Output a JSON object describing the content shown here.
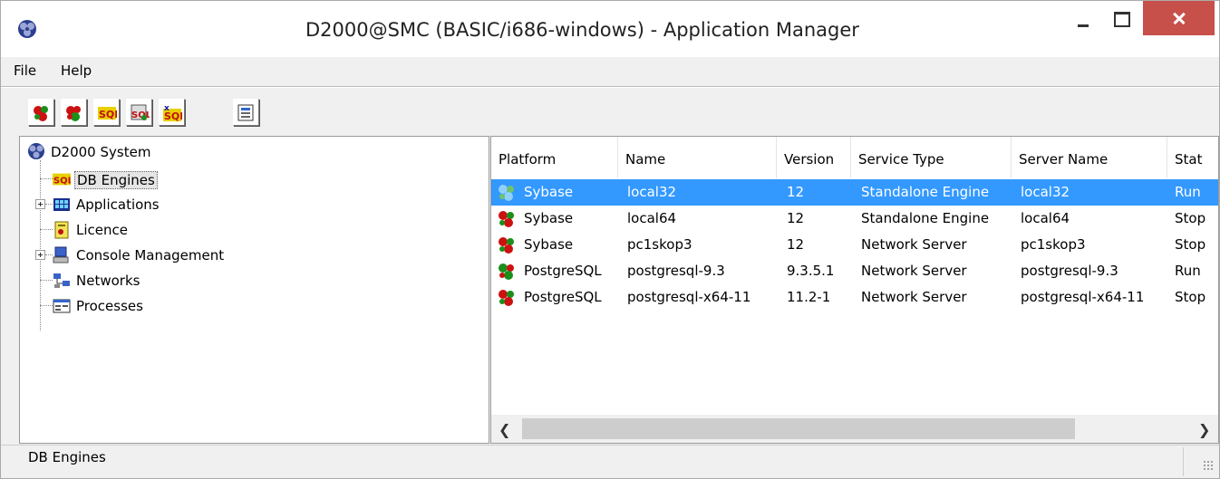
{
  "window": {
    "title": "D2000@SMC (BASIC/i686-windows) - Application Manager"
  },
  "menu": {
    "file": "File",
    "help": "Help"
  },
  "tree": {
    "root": "D2000 System",
    "items": [
      {
        "label": "DB Engines",
        "selected": true,
        "expandable": false
      },
      {
        "label": "Applications",
        "selected": false,
        "expandable": true
      },
      {
        "label": "Licence",
        "selected": false,
        "expandable": false
      },
      {
        "label": "Console Management",
        "selected": false,
        "expandable": true
      },
      {
        "label": "Networks",
        "selected": false,
        "expandable": false
      },
      {
        "label": "Processes",
        "selected": false,
        "expandable": false
      }
    ]
  },
  "grid": {
    "columns": [
      "Platform",
      "Name",
      "Version",
      "Service Type",
      "Server Name",
      "Stat"
    ],
    "rows": [
      {
        "platform": "Sybase",
        "name": "local32",
        "version": "12",
        "service_type": "Standalone Engine",
        "server_name": "local32",
        "status": "Run",
        "selected": true
      },
      {
        "platform": "Sybase",
        "name": "local64",
        "version": "12",
        "service_type": "Standalone Engine",
        "server_name": "local64",
        "status": "Stop",
        "selected": false
      },
      {
        "platform": "Sybase",
        "name": "pc1skop3",
        "version": "12",
        "service_type": "Network Server",
        "server_name": "pc1skop3",
        "status": "Stop",
        "selected": false
      },
      {
        "platform": "PostgreSQL",
        "name": "postgresql-9.3",
        "version": "9.3.5.1",
        "service_type": "Network Server",
        "server_name": "postgresql-9.3",
        "status": "Run",
        "selected": false
      },
      {
        "platform": "PostgreSQL",
        "name": "postgresql-x64-11",
        "version": "11.2-1",
        "service_type": "Network Server",
        "server_name": "postgresql-x64-11",
        "status": "Stop",
        "selected": false
      }
    ]
  },
  "statusbar": {
    "text": "DB Engines"
  },
  "icons": {
    "app": "d2000-logo-icon",
    "db_engine": "db-engine-icon",
    "accent": "#3399ff",
    "close_red": "#c7504b"
  }
}
